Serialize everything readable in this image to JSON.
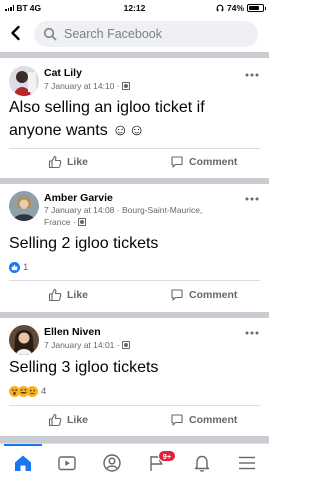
{
  "status_bar": {
    "carrier": "BT",
    "network": "4G",
    "time": "12:12",
    "battery": "74%",
    "battery_level": 0.74
  },
  "header": {
    "search_placeholder": "Search Facebook"
  },
  "posts": [
    {
      "author": "Cat Lily",
      "timestamp": "7 January at 14:10 ·",
      "location": "",
      "text": "Also selling an igloo ticket if anyone wants ☺☺",
      "reaction_count": "",
      "like_label": "Like",
      "comment_label": "Comment"
    },
    {
      "author": "Amber Garvie",
      "timestamp": "7 January at 14:08 ·",
      "location": "Bourg-Saint-Maurice, France ·",
      "text": "Selling 2 igloo tickets",
      "reaction_count": "1",
      "like_label": "Like",
      "comment_label": "Comment"
    },
    {
      "author": "Ellen Niven",
      "timestamp": "7 January at 14:01 ·",
      "location": "",
      "text": "Selling 3 igloo tickets",
      "reaction_count": "4",
      "like_label": "Like",
      "comment_label": "Comment"
    }
  ],
  "tabbar": {
    "items": [
      "home-icon",
      "watch-icon",
      "profile-icon",
      "flag-icon",
      "bell-icon",
      "menu-icon"
    ],
    "notification_badge": "9+"
  },
  "colors": {
    "accent": "#1877f2",
    "badge": "#e41e3f",
    "separator": "#c9ccd1"
  }
}
